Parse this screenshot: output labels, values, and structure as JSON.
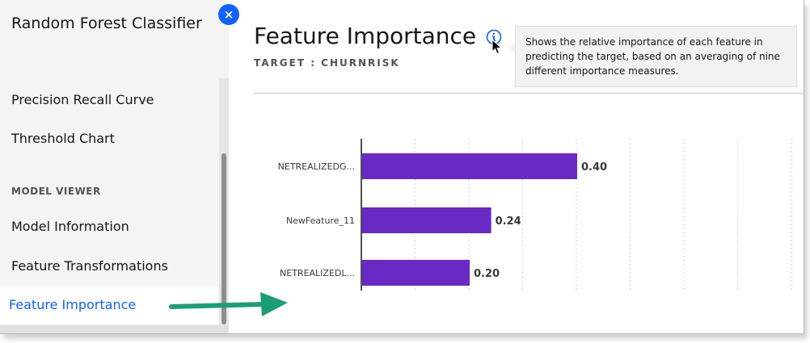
{
  "sidebar": {
    "title": "Random Forest Classifier",
    "close_symbol": "×",
    "items_top": [
      "Precision Recall Curve",
      "Threshold Chart"
    ],
    "section_label": "MODEL VIEWER",
    "items_model": [
      "Model Information",
      "Feature Transformations"
    ],
    "active_item": "Feature Importance"
  },
  "main": {
    "title": "Feature Importance",
    "subtitle": "TARGET : CHURNRISK",
    "tooltip_text": "Shows the relative importance of each feature in predicting the target, based on an averaging of nine different importance measures."
  },
  "colors": {
    "accent": "#0f62fe",
    "bar": "#6929c4",
    "arrow": "#1b9e77"
  },
  "icons": {
    "info": "info-icon",
    "cursor": "cursor-icon",
    "close": "close-icon"
  },
  "chart_data": {
    "type": "bar",
    "orientation": "horizontal",
    "categories": [
      "NETREALIZEDG...",
      "NewFeature_11",
      "NETREALIZEDL..."
    ],
    "values": [
      0.4,
      0.24,
      0.2
    ],
    "value_labels": [
      "0.40",
      "0.24",
      "0.20"
    ],
    "xlim": [
      0,
      0.8
    ],
    "grid": "vertical dashed"
  }
}
